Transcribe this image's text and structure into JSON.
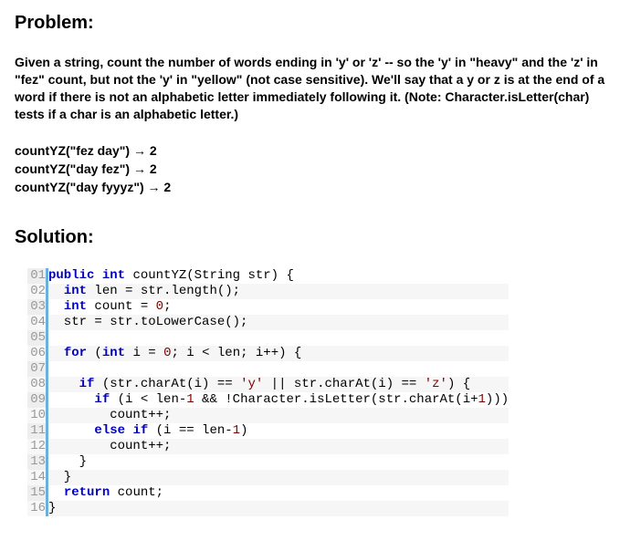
{
  "headings": {
    "problem": "Problem:",
    "solution": "Solution:"
  },
  "problem_description": "Given a string, count the number of words ending in 'y' or 'z' -- so the 'y' in \"heavy\" and the 'z' in \"fez\" count, but not the 'y' in \"yellow\" (not case sensitive). We'll say that a y or z is at the end of a word if there is not an alphabetic letter immediately following it. (Note: Character.isLetter(char) tests if a char is an alphabetic letter.)",
  "examples": [
    "countYZ(\"fez day\") → 2",
    "countYZ(\"day fez\") → 2",
    "countYZ(\"day fyyyz\") → 2"
  ],
  "code_lines": [
    {
      "n": "01",
      "tokens": [
        {
          "t": "public",
          "c": "kw"
        },
        {
          "t": " "
        },
        {
          "t": "int",
          "c": "typ"
        },
        {
          "t": " countYZ(String str) {"
        }
      ]
    },
    {
      "n": "02",
      "tokens": [
        {
          "t": "  "
        },
        {
          "t": "int",
          "c": "typ"
        },
        {
          "t": " len = str.length();"
        }
      ]
    },
    {
      "n": "03",
      "tokens": [
        {
          "t": "  "
        },
        {
          "t": "int",
          "c": "typ"
        },
        {
          "t": " count = "
        },
        {
          "t": "0",
          "c": "num"
        },
        {
          "t": ";"
        }
      ]
    },
    {
      "n": "04",
      "tokens": [
        {
          "t": "  str = str.toLowerCase();"
        }
      ]
    },
    {
      "n": "05",
      "tokens": [
        {
          "t": " "
        }
      ]
    },
    {
      "n": "06",
      "tokens": [
        {
          "t": "  "
        },
        {
          "t": "for",
          "c": "kw"
        },
        {
          "t": " ("
        },
        {
          "t": "int",
          "c": "typ"
        },
        {
          "t": " i = "
        },
        {
          "t": "0",
          "c": "num"
        },
        {
          "t": "; i < len; i++) {"
        }
      ]
    },
    {
      "n": "07",
      "tokens": [
        {
          "t": " "
        }
      ]
    },
    {
      "n": "08",
      "tokens": [
        {
          "t": "    "
        },
        {
          "t": "if",
          "c": "kw"
        },
        {
          "t": " (str.charAt(i) == "
        },
        {
          "t": "'y'",
          "c": "str"
        },
        {
          "t": " || str.charAt(i) == "
        },
        {
          "t": "'z'",
          "c": "str"
        },
        {
          "t": ") {"
        }
      ]
    },
    {
      "n": "09",
      "tokens": [
        {
          "t": "      "
        },
        {
          "t": "if",
          "c": "kw"
        },
        {
          "t": " (i < len-"
        },
        {
          "t": "1",
          "c": "num"
        },
        {
          "t": " && !Character.isLetter(str.charAt(i+"
        },
        {
          "t": "1",
          "c": "num"
        },
        {
          "t": ")))"
        }
      ]
    },
    {
      "n": "10",
      "tokens": [
        {
          "t": "        count++;"
        }
      ]
    },
    {
      "n": "11",
      "tokens": [
        {
          "t": "      "
        },
        {
          "t": "else",
          "c": "kw"
        },
        {
          "t": " "
        },
        {
          "t": "if",
          "c": "kw"
        },
        {
          "t": " (i == len-"
        },
        {
          "t": "1",
          "c": "num"
        },
        {
          "t": ")"
        }
      ]
    },
    {
      "n": "12",
      "tokens": [
        {
          "t": "        count++;"
        }
      ]
    },
    {
      "n": "13",
      "tokens": [
        {
          "t": "    }"
        }
      ]
    },
    {
      "n": "14",
      "tokens": [
        {
          "t": "  }"
        }
      ]
    },
    {
      "n": "15",
      "tokens": [
        {
          "t": "  "
        },
        {
          "t": "return",
          "c": "kw"
        },
        {
          "t": " count;"
        }
      ]
    },
    {
      "n": "16",
      "tokens": [
        {
          "t": "}"
        }
      ]
    }
  ]
}
